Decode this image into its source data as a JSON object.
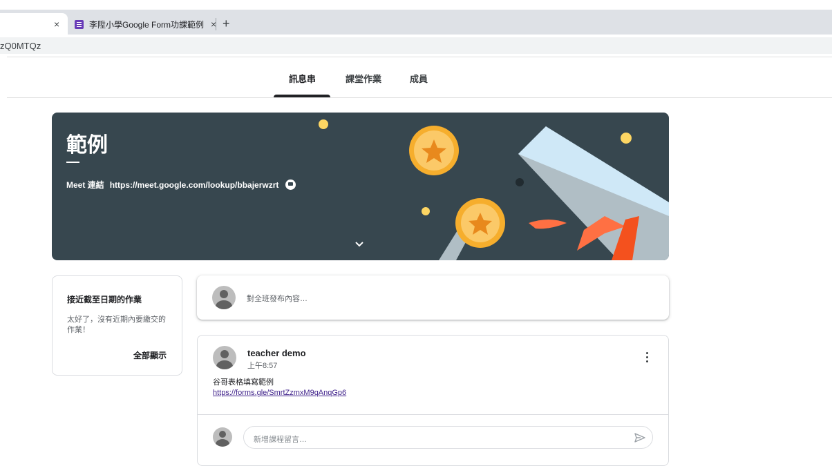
{
  "browser": {
    "active_tab_close": "×",
    "tab2_title": "李陞小學Google Form功課範例",
    "tab2_close": "×",
    "new_tab": "+",
    "url": "zQ0MTQz"
  },
  "nav": {
    "tabs": [
      {
        "label": "訊息串",
        "active": true
      },
      {
        "label": "課堂作業",
        "active": false
      },
      {
        "label": "成員",
        "active": false
      }
    ]
  },
  "banner": {
    "title": "範例",
    "meet_label": "Meet 連結",
    "meet_url": "https://meet.google.com/lookup/bbajerwzrt",
    "bg_color": "#37474f"
  },
  "upcoming": {
    "title": "接近截至日期的作業",
    "message": "太好了，沒有近期內要繳交的作業！",
    "view_all": "全部顯示"
  },
  "announce": {
    "placeholder": "對全班發布內容…"
  },
  "post": {
    "author": "teacher demo",
    "time": "上午8:57",
    "body": "谷哥表格填寫範例",
    "link": "https://forms.gle/SmrtZzmxM9qAnqGp6",
    "comment_placeholder": "新增課程留言…"
  },
  "icons": {
    "forms": "google-forms-icon",
    "meet": "meet-icon",
    "chevron": "chevron-down-icon",
    "kebab": "more-vert-icon",
    "send": "send-icon"
  }
}
